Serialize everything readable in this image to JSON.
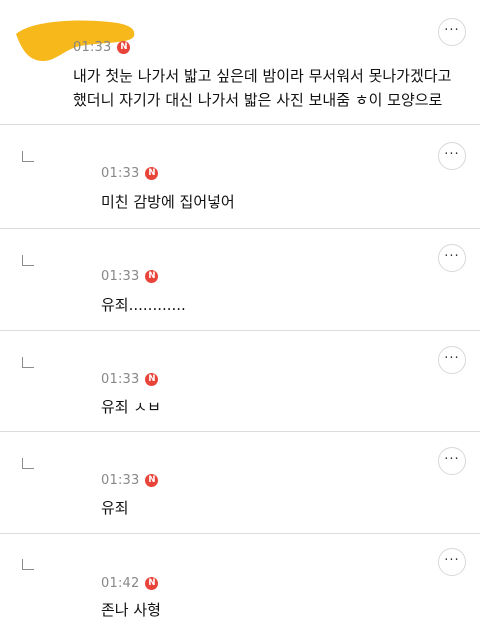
{
  "colors": {
    "badge": "#e8443a",
    "highlight": "#f7b81c",
    "divider": "#dcdcdc"
  },
  "comments": [
    {
      "time": "01:33",
      "badge": "N",
      "text": "내가 첫눈 나가서 밟고 싶은데 밤이라 무서워서 못나가겠다고\n했더니 자기가 대신 나가서 밟은 사진 보내줌 ㅎ이 모양으로",
      "more": "···"
    },
    {
      "time": "01:33",
      "badge": "N",
      "text": "미친 감방에 집어넣어",
      "more": "···"
    },
    {
      "time": "01:33",
      "badge": "N",
      "text": "유죄............",
      "more": "···"
    },
    {
      "time": "01:33",
      "badge": "N",
      "text": "유죄 ㅅㅂ",
      "more": "···"
    },
    {
      "time": "01:33",
      "badge": "N",
      "text": "유죄",
      "more": "···"
    },
    {
      "time": "01:42",
      "badge": "N",
      "text": "존나 사형",
      "more": "···"
    }
  ]
}
